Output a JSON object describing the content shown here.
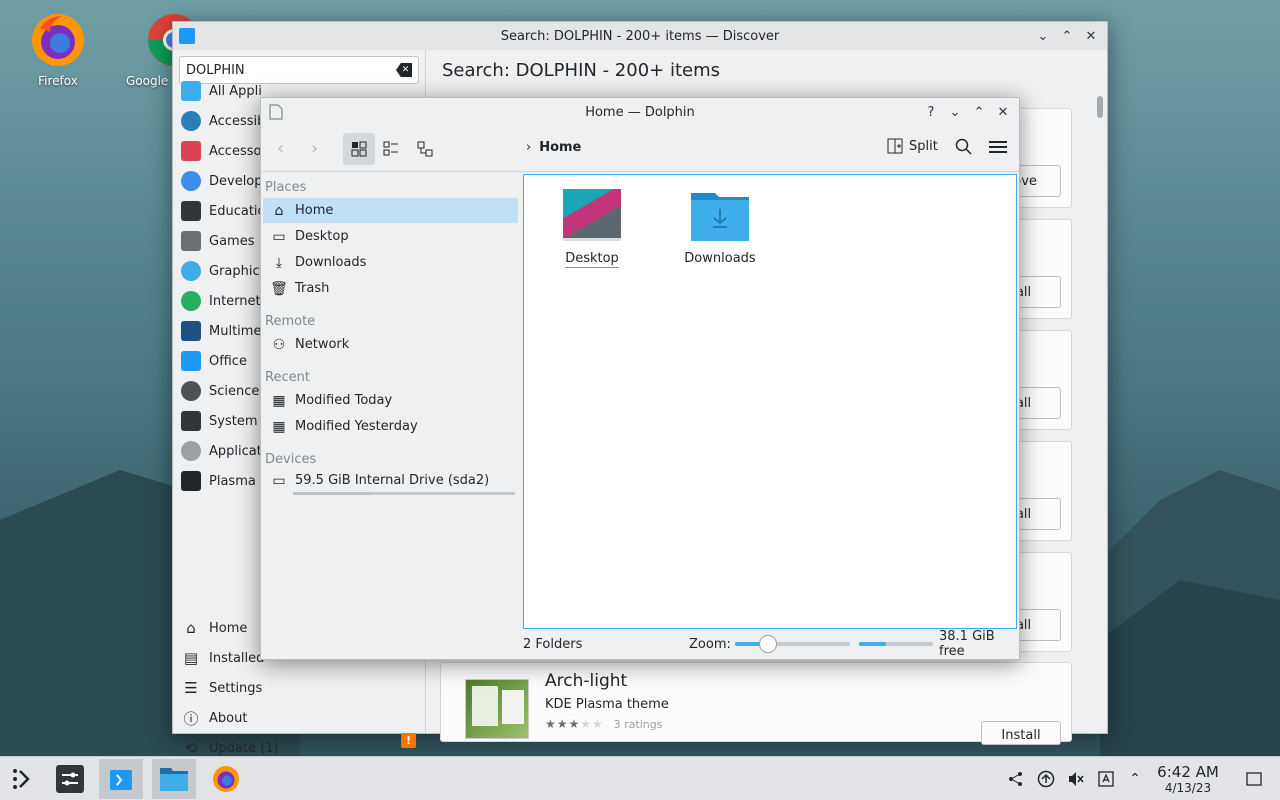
{
  "desktop": {
    "icons": [
      {
        "label": "Firefox",
        "icon": "firefox-icon"
      },
      {
        "label": "Google",
        "icon": "chrome-icon"
      }
    ]
  },
  "discover": {
    "title": "Search: DOLPHIN - 200+ items — Discover",
    "search_value": "DOLPHIN",
    "header": "Search: DOLPHIN - 200+ items",
    "categories": [
      {
        "label": "All Appli",
        "icon": "grid-icon",
        "color": "#3daee9"
      },
      {
        "label": "Accessib",
        "icon": "accessibility-icon",
        "color": "#2980b9"
      },
      {
        "label": "Accesso",
        "icon": "toolbox-icon",
        "color": "#da4453"
      },
      {
        "label": "Develop",
        "icon": "developer-icon",
        "color": "#3d8ee9"
      },
      {
        "label": "Educatio",
        "icon": "education-icon",
        "color": "#31363b"
      },
      {
        "label": "Games",
        "icon": "gamepad-icon",
        "color": "#6b6f73"
      },
      {
        "label": "Graphics",
        "icon": "graphics-icon",
        "color": "#3daee9"
      },
      {
        "label": "Internet",
        "icon": "globe-icon",
        "color": "#27ae60"
      },
      {
        "label": "Multime",
        "icon": "multimedia-icon",
        "color": "#1d4f80"
      },
      {
        "label": "Office",
        "icon": "office-icon",
        "color": "#1d99f3"
      },
      {
        "label": "Science",
        "icon": "science-icon",
        "color": "#4d5357"
      },
      {
        "label": "System s",
        "icon": "terminal-icon",
        "color": "#31363b"
      },
      {
        "label": "Applicat",
        "icon": "more-icon",
        "color": "#9aa0a4"
      },
      {
        "label": "Plasma A",
        "icon": "plasma-icon",
        "color": "#232629"
      }
    ],
    "bottom_nav": [
      {
        "label": "Home",
        "icon": "home-icon"
      },
      {
        "label": "Installed",
        "icon": "installed-icon"
      },
      {
        "label": "Settings",
        "icon": "settings-icon"
      },
      {
        "label": "About",
        "icon": "info-icon"
      },
      {
        "label": "Update (1)",
        "icon": "update-icon"
      }
    ],
    "cards": [
      {
        "button": "nove"
      },
      {
        "button": "tall"
      },
      {
        "button": "tall"
      },
      {
        "button": "tall"
      },
      {
        "button": "tall"
      }
    ],
    "arch_card": {
      "name": "Arch-light",
      "subtitle": "KDE Plasma theme",
      "ratings": "3 ratings",
      "stars": 3,
      "button": "Install"
    }
  },
  "dolphin": {
    "title": "Home — Dolphin",
    "breadcrumb": "Home",
    "split_label": "Split",
    "sections": {
      "places": "Places",
      "remote": "Remote",
      "recent": "Recent",
      "devices": "Devices"
    },
    "places": [
      {
        "label": "Home",
        "icon": "home-icon",
        "selected": true
      },
      {
        "label": "Desktop",
        "icon": "desktop-icon"
      },
      {
        "label": "Downloads",
        "icon": "download-icon"
      },
      {
        "label": "Trash",
        "icon": "trash-icon"
      }
    ],
    "remote": [
      {
        "label": "Network",
        "icon": "network-icon"
      }
    ],
    "recent": [
      {
        "label": "Modified Today",
        "icon": "calendar-icon"
      },
      {
        "label": "Modified Yesterday",
        "icon": "calendar-icon"
      }
    ],
    "devices": [
      {
        "label": "59.5 GiB Internal Drive (sda2)",
        "icon": "drive-icon"
      }
    ],
    "files": [
      {
        "label": "Desktop",
        "icon": "desktop-folder-icon"
      },
      {
        "label": "Downloads",
        "icon": "downloads-folder-icon"
      }
    ],
    "status": {
      "count": "2 Folders",
      "zoom_label": "Zoom:",
      "free": "38.1 GiB free"
    }
  },
  "taskbar": {
    "time": "6:42 AM",
    "date": "4/13/23"
  },
  "colors": {
    "accent": "#3daee9",
    "selection": "#c2e0f5",
    "update_badge": "#f67400"
  }
}
